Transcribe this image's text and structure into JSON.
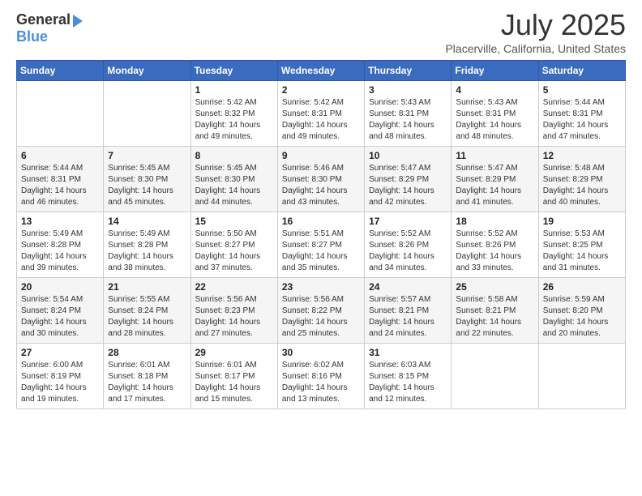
{
  "header": {
    "logo_general": "General",
    "logo_blue": "Blue",
    "title": "July 2025",
    "subtitle": "Placerville, California, United States"
  },
  "weekdays": [
    "Sunday",
    "Monday",
    "Tuesday",
    "Wednesday",
    "Thursday",
    "Friday",
    "Saturday"
  ],
  "weeks": [
    [
      {
        "day": "",
        "info": ""
      },
      {
        "day": "",
        "info": ""
      },
      {
        "day": "1",
        "info": "Sunrise: 5:42 AM\nSunset: 8:32 PM\nDaylight: 14 hours and 49 minutes."
      },
      {
        "day": "2",
        "info": "Sunrise: 5:42 AM\nSunset: 8:31 PM\nDaylight: 14 hours and 49 minutes."
      },
      {
        "day": "3",
        "info": "Sunrise: 5:43 AM\nSunset: 8:31 PM\nDaylight: 14 hours and 48 minutes."
      },
      {
        "day": "4",
        "info": "Sunrise: 5:43 AM\nSunset: 8:31 PM\nDaylight: 14 hours and 48 minutes."
      },
      {
        "day": "5",
        "info": "Sunrise: 5:44 AM\nSunset: 8:31 PM\nDaylight: 14 hours and 47 minutes."
      }
    ],
    [
      {
        "day": "6",
        "info": "Sunrise: 5:44 AM\nSunset: 8:31 PM\nDaylight: 14 hours and 46 minutes."
      },
      {
        "day": "7",
        "info": "Sunrise: 5:45 AM\nSunset: 8:30 PM\nDaylight: 14 hours and 45 minutes."
      },
      {
        "day": "8",
        "info": "Sunrise: 5:45 AM\nSunset: 8:30 PM\nDaylight: 14 hours and 44 minutes."
      },
      {
        "day": "9",
        "info": "Sunrise: 5:46 AM\nSunset: 8:30 PM\nDaylight: 14 hours and 43 minutes."
      },
      {
        "day": "10",
        "info": "Sunrise: 5:47 AM\nSunset: 8:29 PM\nDaylight: 14 hours and 42 minutes."
      },
      {
        "day": "11",
        "info": "Sunrise: 5:47 AM\nSunset: 8:29 PM\nDaylight: 14 hours and 41 minutes."
      },
      {
        "day": "12",
        "info": "Sunrise: 5:48 AM\nSunset: 8:29 PM\nDaylight: 14 hours and 40 minutes."
      }
    ],
    [
      {
        "day": "13",
        "info": "Sunrise: 5:49 AM\nSunset: 8:28 PM\nDaylight: 14 hours and 39 minutes."
      },
      {
        "day": "14",
        "info": "Sunrise: 5:49 AM\nSunset: 8:28 PM\nDaylight: 14 hours and 38 minutes."
      },
      {
        "day": "15",
        "info": "Sunrise: 5:50 AM\nSunset: 8:27 PM\nDaylight: 14 hours and 37 minutes."
      },
      {
        "day": "16",
        "info": "Sunrise: 5:51 AM\nSunset: 8:27 PM\nDaylight: 14 hours and 35 minutes."
      },
      {
        "day": "17",
        "info": "Sunrise: 5:52 AM\nSunset: 8:26 PM\nDaylight: 14 hours and 34 minutes."
      },
      {
        "day": "18",
        "info": "Sunrise: 5:52 AM\nSunset: 8:26 PM\nDaylight: 14 hours and 33 minutes."
      },
      {
        "day": "19",
        "info": "Sunrise: 5:53 AM\nSunset: 8:25 PM\nDaylight: 14 hours and 31 minutes."
      }
    ],
    [
      {
        "day": "20",
        "info": "Sunrise: 5:54 AM\nSunset: 8:24 PM\nDaylight: 14 hours and 30 minutes."
      },
      {
        "day": "21",
        "info": "Sunrise: 5:55 AM\nSunset: 8:24 PM\nDaylight: 14 hours and 28 minutes."
      },
      {
        "day": "22",
        "info": "Sunrise: 5:56 AM\nSunset: 8:23 PM\nDaylight: 14 hours and 27 minutes."
      },
      {
        "day": "23",
        "info": "Sunrise: 5:56 AM\nSunset: 8:22 PM\nDaylight: 14 hours and 25 minutes."
      },
      {
        "day": "24",
        "info": "Sunrise: 5:57 AM\nSunset: 8:21 PM\nDaylight: 14 hours and 24 minutes."
      },
      {
        "day": "25",
        "info": "Sunrise: 5:58 AM\nSunset: 8:21 PM\nDaylight: 14 hours and 22 minutes."
      },
      {
        "day": "26",
        "info": "Sunrise: 5:59 AM\nSunset: 8:20 PM\nDaylight: 14 hours and 20 minutes."
      }
    ],
    [
      {
        "day": "27",
        "info": "Sunrise: 6:00 AM\nSunset: 8:19 PM\nDaylight: 14 hours and 19 minutes."
      },
      {
        "day": "28",
        "info": "Sunrise: 6:01 AM\nSunset: 8:18 PM\nDaylight: 14 hours and 17 minutes."
      },
      {
        "day": "29",
        "info": "Sunrise: 6:01 AM\nSunset: 8:17 PM\nDaylight: 14 hours and 15 minutes."
      },
      {
        "day": "30",
        "info": "Sunrise: 6:02 AM\nSunset: 8:16 PM\nDaylight: 14 hours and 13 minutes."
      },
      {
        "day": "31",
        "info": "Sunrise: 6:03 AM\nSunset: 8:15 PM\nDaylight: 14 hours and 12 minutes."
      },
      {
        "day": "",
        "info": ""
      },
      {
        "day": "",
        "info": ""
      }
    ]
  ]
}
